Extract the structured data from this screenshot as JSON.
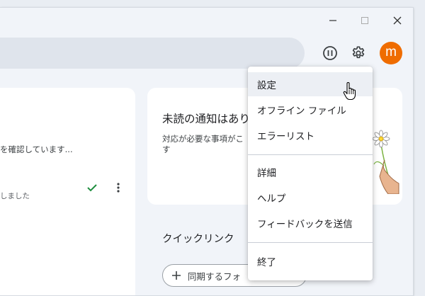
{
  "titlebar": {
    "minimize_icon": "minimize-icon",
    "maximize_icon": "maximize-icon",
    "close_icon": "close-icon"
  },
  "header": {
    "pause_icon": "pause-icon",
    "settings_icon": "gear-icon",
    "avatar_initial": "m",
    "avatar_color": "#ef6c00"
  },
  "left_card": {
    "status_text": "を確認しています...",
    "done_text": "しました",
    "check_icon": "check-icon",
    "more_icon": "more-vertical-icon"
  },
  "notification_card": {
    "title": "未読の通知はあり",
    "body_line1": "対応が必要な事項がこ",
    "body_line2": "す"
  },
  "quick_links": {
    "heading": "クイックリンク",
    "sync_button_label": "同期するフォ"
  },
  "settings_menu": {
    "items": [
      {
        "label": "設定"
      },
      {
        "label": "オフライン ファイル"
      },
      {
        "label": "エラーリスト"
      },
      {
        "label": "詳細"
      },
      {
        "label": "ヘルプ"
      },
      {
        "label": "フィードバックを送信"
      },
      {
        "label": "終了"
      }
    ]
  },
  "colors": {
    "accent_check": "#1e8e3e",
    "menu_hover": "#eceff4"
  }
}
